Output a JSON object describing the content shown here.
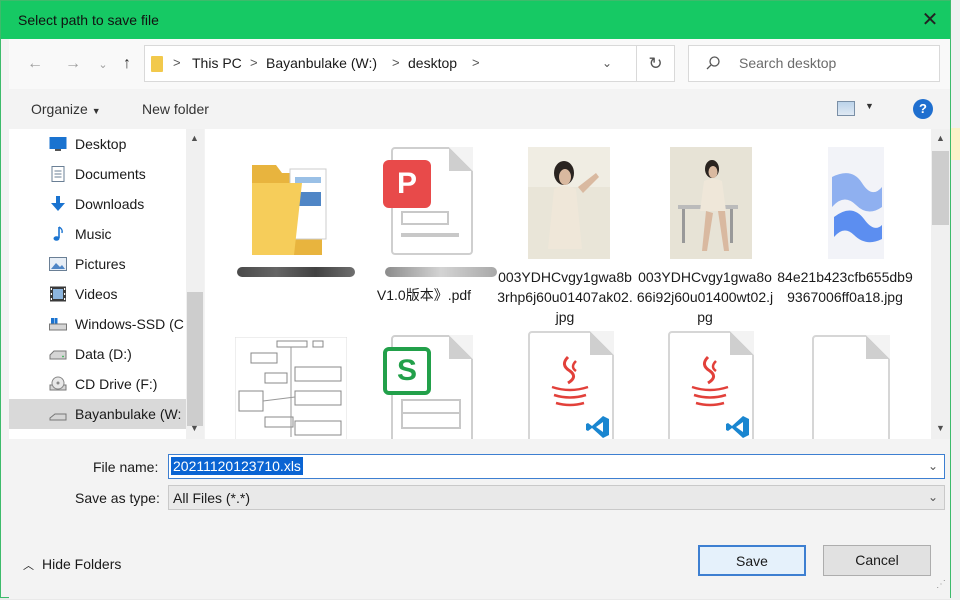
{
  "window": {
    "title": "Select path to save file"
  },
  "address": {
    "crumbs": [
      "This PC",
      "Bayanbulake (W:)",
      "desktop"
    ],
    "search_placeholder": "Search desktop"
  },
  "toolbar": {
    "organize": "Organize",
    "new_folder": "New folder",
    "help": "?"
  },
  "nav": {
    "items": [
      {
        "label": "Desktop",
        "icon": "desktop-icon"
      },
      {
        "label": "Documents",
        "icon": "documents-icon"
      },
      {
        "label": "Downloads",
        "icon": "downloads-icon"
      },
      {
        "label": "Music",
        "icon": "music-icon"
      },
      {
        "label": "Pictures",
        "icon": "pictures-icon"
      },
      {
        "label": "Videos",
        "icon": "videos-icon"
      },
      {
        "label": "Windows-SSD (C",
        "icon": "drive-icon"
      },
      {
        "label": "Data (D:)",
        "icon": "drive-icon"
      },
      {
        "label": "CD Drive (F:)",
        "icon": "cd-drive-icon"
      },
      {
        "label": "Bayanbulake (W:",
        "icon": "network-drive-icon",
        "selected": true
      }
    ]
  },
  "files": [
    {
      "name": "",
      "kind": "folder"
    },
    {
      "name": "V1.0版本》.pdf",
      "kind": "pdf"
    },
    {
      "name": "003YDHCvgy1gwa8b3rhp6j60u01407ak02.jpg",
      "kind": "photo"
    },
    {
      "name": "003YDHCvgy1gwa8o66i92j60u01400wt02.jpg",
      "kind": "photo"
    },
    {
      "name": "84e21b423cfb655db99367006ff0a18.jpg",
      "kind": "image-blue"
    },
    {
      "name": "",
      "kind": "diagram"
    },
    {
      "name": "",
      "kind": "sheet"
    },
    {
      "name": "",
      "kind": "java"
    },
    {
      "name": "",
      "kind": "java"
    },
    {
      "name": "",
      "kind": "blank"
    }
  ],
  "form": {
    "file_name_label": "File name:",
    "file_name_value": "20211120123710.xls",
    "save_type_label": "Save as type:",
    "save_type_value": "All Files (*.*)"
  },
  "buttons": {
    "hide_folders": "Hide Folders",
    "save": "Save",
    "cancel": "Cancel"
  },
  "colors": {
    "titlebar": "#16c964",
    "accent": "#0a64d3"
  }
}
